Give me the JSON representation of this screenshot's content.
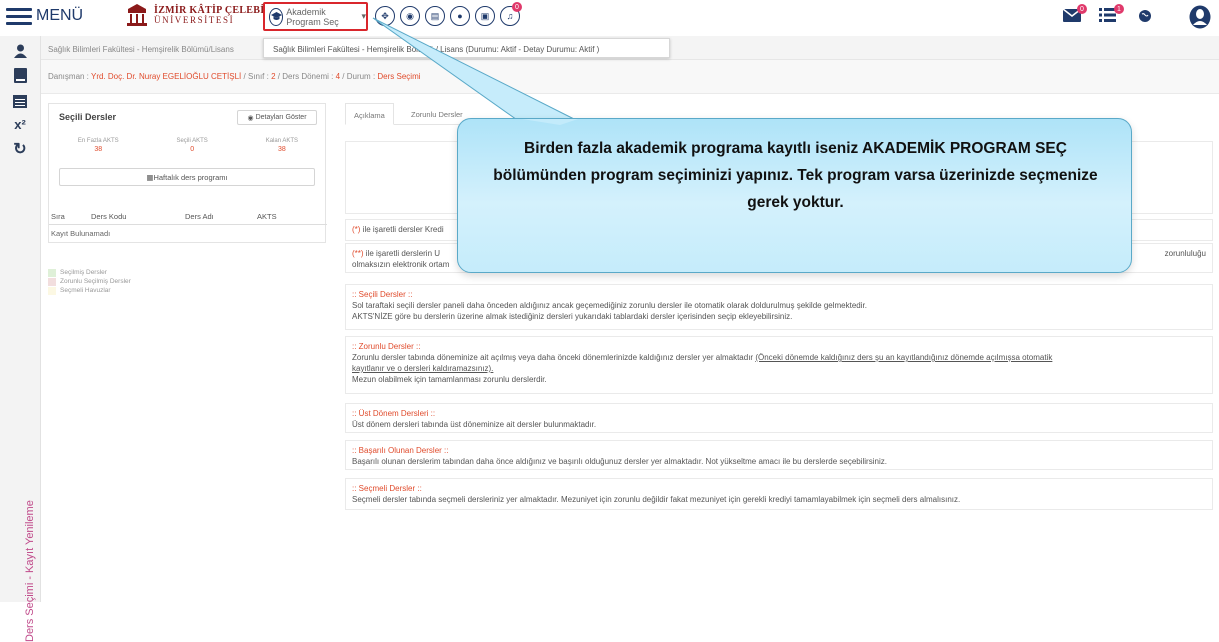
{
  "header": {
    "menu_label": "MENÜ",
    "logo_line1": "İZMİR KÂTİP ÇELEBİ",
    "logo_line2": "ÜNİVERSİTESİ",
    "program_select_label": "Akademik Program Seç",
    "program_select_caret": "▾",
    "bell_badge": "0",
    "mail_badge": "0",
    "list_badge": "1"
  },
  "breadcrumb": {
    "text": "Sağlık Bilimleri Fakültesi - Hemşirelik Bölümü/Lisans"
  },
  "dropdown": {
    "option": "Sağlık Bilimleri Fakültesi - Hemşirelik Bölümü / Lisans (Durumu: Aktif - Detay Durumu: Aktif )"
  },
  "info": {
    "advisor_label": "Danışman :",
    "advisor_name": "Yrd. Doç. Dr. Nuray EGELİOĞLU CETİŞLİ",
    "class_label": "Sınıf :",
    "class_value": "2",
    "term_label": "Ders Dönemi :",
    "term_value": "4",
    "status_label": "Durum :",
    "status_value": "Ders Seçimi"
  },
  "left_panel": {
    "title": "Seçili Dersler",
    "details_button": "Detayları Göster",
    "stats": [
      {
        "label": "En Fazla AKTS",
        "value": "38"
      },
      {
        "label": "Seçili AKTS",
        "value": "0"
      },
      {
        "label": "Kalan AKTS",
        "value": "38"
      }
    ],
    "weekly_button": "Haftalık ders programı",
    "columns": [
      "Sıra",
      "Ders Kodu",
      "Ders Adı",
      "AKTS"
    ],
    "empty_text": "Kayıt Bulunamadı"
  },
  "legend": [
    {
      "label": "Seçilmiş Dersler",
      "color": "#dff0d8"
    },
    {
      "label": "Zorunlu Seçilmiş Dersler",
      "color": "#f2dede"
    },
    {
      "label": "Seçmeli Havuzlar",
      "color": "#fcf8e3"
    }
  ],
  "tabs": [
    "Açıklama",
    "Zorunlu Dersler"
  ],
  "content": {
    "note1_mark": "(*)",
    "note1_text": " ile işaretli dersler Kredi",
    "note2_mark": "(**)",
    "note2_text": " ile işaretli derslerin U",
    "note2_tail": "zorunluluğu",
    "note2_line2": "olmaksızın elektronik ortam",
    "s1_title": ":: Seçili Dersler ::",
    "s1_l1": "Sol taraftaki seçili dersler paneli daha önceden aldığınız ancak geçemediğiniz zorunlu dersler ile otomatik olarak doldurulmuş şekilde gelmektedir.",
    "s1_l2": "AKTS'NİZE göre bu derslerin üzerine almak istediğiniz dersleri yukarıdaki tablardaki dersler içerisinden seçip ekleyebilirsiniz.",
    "s2_title": ":: Zorunlu Dersler ::",
    "s2_l1": "Zorunlu dersler tabında döneminize ait açılmış veya daha önceki dönemlerinizde kaldığınız dersler yer almaktadır ",
    "s2_l1u": "(Önceki dönemde kaldığınız ders şu an kayıtlandığınız dönemde açılmışsa otomatik",
    "s2_l2u": "kayıtlanır ve o dersleri kaldıramazsınız).",
    "s2_l3": "Mezun olabilmek için tamamlanması zorunlu derslerdir.",
    "s3_title": ":: Üst Dönem Dersleri ::",
    "s3_l1": "Üst dönem dersleri tabında üst döneminize ait dersler bulunmaktadır.",
    "s4_title": ":: Başarılı Olunan Dersler ::",
    "s4_l1": "Başarılı olunan derslerim tabından daha önce aldığınız ve başırılı olduğunuz dersler yer almaktadır. Not yükseltme amacı ile bu derslerde seçebilirsiniz.",
    "s5_title": ":: Seçmeli Dersler ::",
    "s5_l1": "Seçmeli dersler tabında seçmeli dersleriniz yer almaktadır. Mezuniyet için zorunlu değildir fakat mezuniyet için gerekli krediyi tamamlayabilmek için seçmeli ders almalısınız."
  },
  "callout": {
    "text": "Birden fazla akademik programa kayıtlı iseniz AKADEMİK PROGRAM SEÇ bölümünden program seçiminizi yapınız. Tek program varsa üzerinizde seçmenize gerek yoktur."
  },
  "sidebar": {
    "vertical_label": "Ders Seçimi - Kayıt Yenileme",
    "formula_icon_text": "x²"
  }
}
